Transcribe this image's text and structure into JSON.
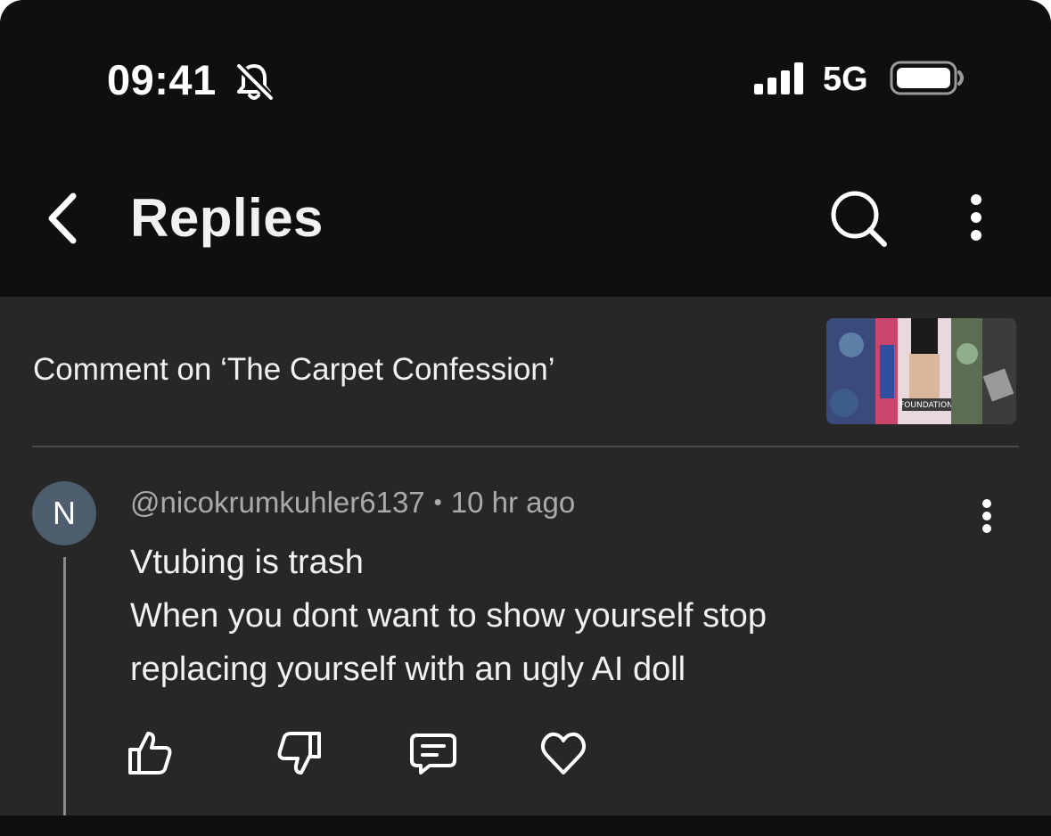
{
  "status_bar": {
    "time": "09:41",
    "network": "5G",
    "icons": [
      "bell-slash-icon",
      "signal-icon",
      "battery-icon"
    ]
  },
  "header": {
    "title": "Replies",
    "icons": [
      "back-arrow-icon",
      "search-icon",
      "more-vert-icon"
    ]
  },
  "context": {
    "text": "Comment on ‘The Carpet Confession’",
    "thumbnail_caption": "FOUNDATION"
  },
  "comment": {
    "avatar_letter": "N",
    "handle": "@nicokrumkuhler6137",
    "separator": "•",
    "time": "10 hr ago",
    "lines": [
      "Vtubing is trash",
      "When you dont want to show yourself stop",
      "replacing yourself with an ugly AI doll"
    ],
    "actions": [
      "thumbs-up-icon",
      "thumbs-down-icon",
      "reply-icon",
      "heart-icon"
    ]
  },
  "colors": {
    "background": "#0f0f0f",
    "sheet": "#272727",
    "text_primary": "#f1f1f1",
    "text_secondary": "#aaaaaa",
    "avatar": "#4f5e6e"
  }
}
